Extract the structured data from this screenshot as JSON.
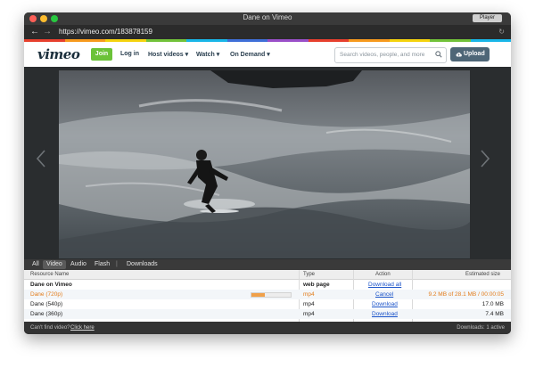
{
  "window": {
    "title": "Dane on Vimeo",
    "player_button": "Player"
  },
  "browser": {
    "url": "https://vimeo.com/183878159",
    "back_glyph": "←",
    "forward_glyph": "→",
    "reload_glyph": "↻"
  },
  "colors": {
    "brand_green": "#6bc238",
    "vimeo_navy": "#1a2e3b",
    "progress_orange": "#f0a049",
    "link_blue": "#1a53c9"
  },
  "vimeo": {
    "logo": "vimeo",
    "join_label": "Join",
    "nav": [
      {
        "label": "Log in"
      },
      {
        "label": "Host videos",
        "chevron": "▾"
      },
      {
        "label": "Watch",
        "chevron": "▾"
      },
      {
        "label": "On Demand",
        "chevron": "▾"
      }
    ],
    "search_placeholder": "Search videos, people, and more",
    "upload_label": "Upload"
  },
  "video": {
    "prev_icon": "chevron-left-icon",
    "next_icon": "chevron-right-icon"
  },
  "downloader": {
    "filter_tabs": [
      "All",
      "Video",
      "Audio",
      "Flash"
    ],
    "active_tab": "Video",
    "tab_separator": "|",
    "downloads_tab": "Downloads",
    "columns": [
      "Resource Name",
      "Type",
      "Action",
      "Estimated size"
    ],
    "rows": [
      {
        "name": "Dane on Vimeo",
        "type": "web page",
        "action": "Download all",
        "size": ""
      },
      {
        "name": "Dane (720p)",
        "type": "mp4",
        "action": "Cancel",
        "size": "9.2 MB of 28.1 MB / 00:00:05",
        "progress": 0.33
      },
      {
        "name": "Dane (540p)",
        "type": "mp4",
        "action": "Download",
        "size": "17.0 MB"
      },
      {
        "name": "Dane (360p)",
        "type": "mp4",
        "action": "Download",
        "size": "7.4 MB"
      }
    ]
  },
  "status": {
    "question": "Can't find video?",
    "help_link": "Click here",
    "downloads": "Downloads: 1 active"
  }
}
